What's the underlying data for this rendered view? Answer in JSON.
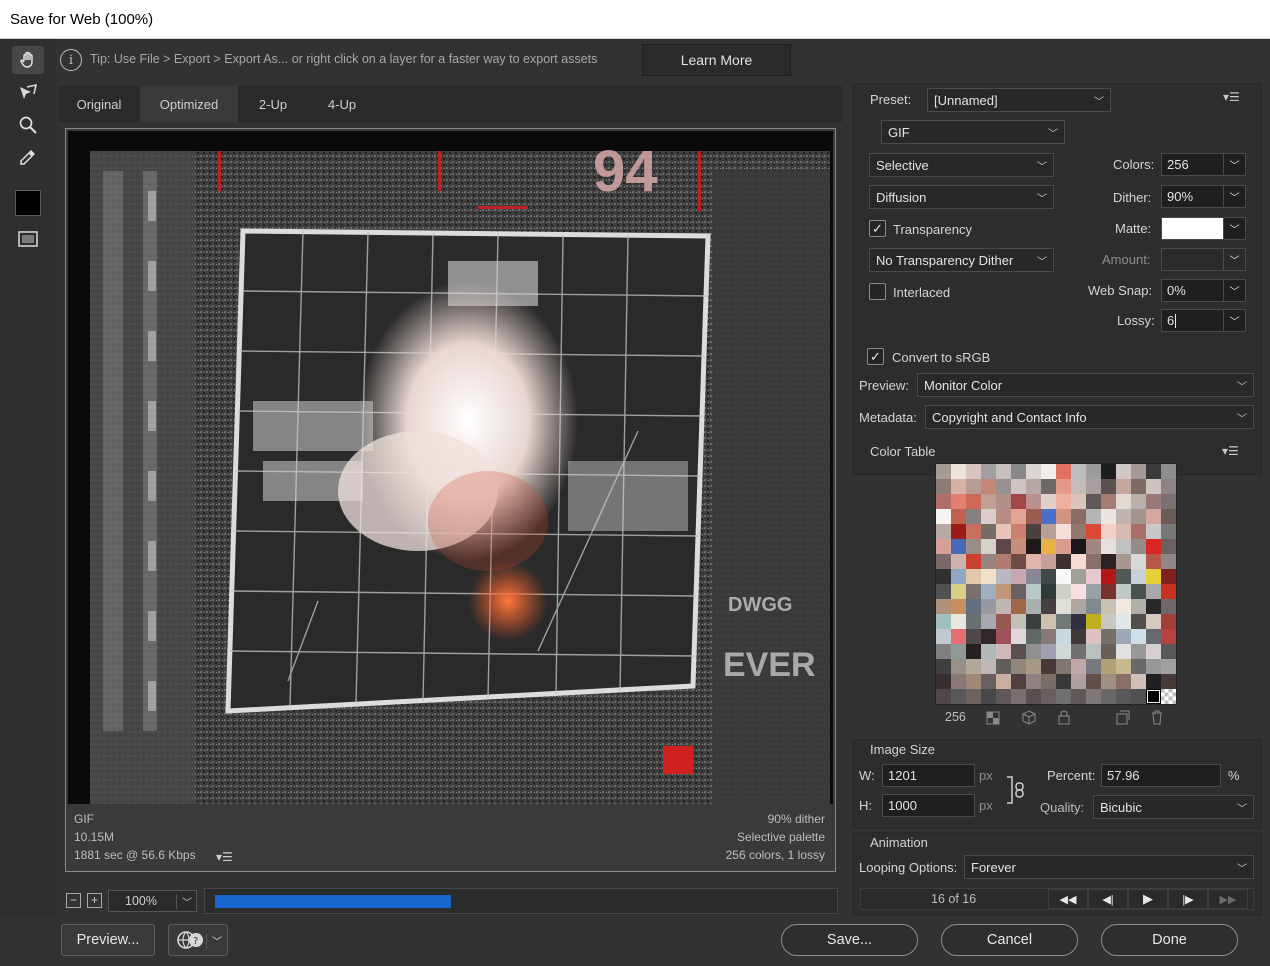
{
  "window": {
    "title": "Save for Web (100%)"
  },
  "tools": [
    {
      "name": "hand-tool",
      "icon": "hand-icon"
    },
    {
      "name": "slice-select-tool",
      "icon": "slice-select-icon"
    },
    {
      "name": "zoom-tool",
      "icon": "magnifier-icon"
    },
    {
      "name": "eyedropper-tool",
      "icon": "eyedropper-icon"
    },
    {
      "name": "eyedropper-color",
      "icon": "color-swatch-icon",
      "color": "#000000"
    },
    {
      "name": "toggle-slices-visibility",
      "icon": "slices-visibility-icon"
    }
  ],
  "tip": {
    "text": "Tip: Use File > Export > Export As...  or right click on a layer for a faster way to export assets",
    "learn_more": "Learn More"
  },
  "tabs": [
    {
      "label": "Original",
      "selected": false
    },
    {
      "label": "Optimized",
      "selected": true
    },
    {
      "label": "2-Up",
      "selected": false
    },
    {
      "label": "4-Up",
      "selected": false
    }
  ],
  "image_info": {
    "format": "GIF",
    "size": "10.15M",
    "download": "1881 sec @ 56.6 Kbps",
    "dither": "90% dither",
    "palette": "Selective palette",
    "summary": "256 colors, 1 lossy"
  },
  "zoom": {
    "value": "100%",
    "progress_fraction": 0.385
  },
  "buttons": {
    "preview": "Preview...",
    "save": "Save...",
    "cancel": "Cancel",
    "done": "Done"
  },
  "settings": {
    "preset_label": "Preset:",
    "preset_value": "[Unnamed]",
    "format": "GIF",
    "reduction": "Selective",
    "dither_algo": "Diffusion",
    "transparency_label": "Transparency",
    "transparency_checked": true,
    "transparency_dither": "No Transparency Dither",
    "interlaced_label": "Interlaced",
    "interlaced_checked": false,
    "colors_label": "Colors:",
    "colors_value": "256",
    "dither_label": "Dither:",
    "dither_value": "90%",
    "matte_label": "Matte:",
    "matte_color": "#ffffff",
    "amount_label": "Amount:",
    "amount_value": "",
    "websnap_label": "Web Snap:",
    "websnap_value": "0%",
    "lossy_label": "Lossy:",
    "lossy_value": "6",
    "convert_srgb_label": "Convert to sRGB",
    "convert_srgb_checked": true,
    "preview_label": "Preview:",
    "preview_value": "Monitor Color",
    "metadata_label": "Metadata:",
    "metadata_value": "Copyright and Contact Info"
  },
  "color_table": {
    "title": "Color Table",
    "count": "256",
    "colors": [
      "#a59c95",
      "#ece2df",
      "#d8c5c1",
      "#a0a0a0",
      "#c8c0bc",
      "#888888",
      "#dcd4d2",
      "#f4eeea",
      "#e07060",
      "#bcbcbc",
      "#9c9c9c",
      "#1e1e1e",
      "#cfc8c4",
      "#a89898",
      "#3a3a3a",
      "#8e8e8e",
      "#8c7a74",
      "#d8b0a6",
      "#b89c94",
      "#c48878",
      "#989090",
      "#d0c4c0",
      "#b4a8a4",
      "#6c6868",
      "#e89888",
      "#c4bcb8",
      "#a8a0a0",
      "#5c5050",
      "#c4a8a0",
      "#7c6c68",
      "#ccc4c0",
      "#8c8484",
      "#b07068",
      "#e48070",
      "#d06858",
      "#c0a094",
      "#b09088",
      "#a04848",
      "#bc9090",
      "#e0d0cc",
      "#f0b0a0",
      "#dcc4bc",
      "#605858",
      "#a47c74",
      "#e4d8d4",
      "#b8b0ac",
      "#987878",
      "#7c7070",
      "#f8f4f2",
      "#c06050",
      "#888080",
      "#dccccc",
      "#b88c84",
      "#e4a494",
      "#9c5c54",
      "#4c70c8",
      "#d09484",
      "#8c6c64",
      "#b4b4b4",
      "#ece4e0",
      "#c0b4b0",
      "#a49490",
      "#d4a8a0",
      "#6c5c58",
      "#b8a8a4",
      "#9c1c1c",
      "#c87060",
      "#786c68",
      "#e8c4b8",
      "#cc8070",
      "#4c4040",
      "#b8a098",
      "#f4e0d8",
      "#907870",
      "#dc4838",
      "#f0d0c8",
      "#d8b8b0",
      "#a87068",
      "#c8c8c8",
      "#787878",
      "#d8a098",
      "#4868b8",
      "#9c8c88",
      "#d8d0cc",
      "#5c4848",
      "#c4907c",
      "#201818",
      "#e8b048",
      "#d89c90",
      "#181818",
      "#a08880",
      "#e8e0dc",
      "#c0c0c0",
      "#948c88",
      "#d82820",
      "#6c6060",
      "#7c6868",
      "#ccb4ac",
      "#c84030",
      "#988480",
      "#b07c70",
      "#6c4c44",
      "#e0b4a8",
      "#c4a098",
      "#3c3030",
      "#f8dcd0",
      "#887070",
      "#2c2424",
      "#a89890",
      "#d8d8d8",
      "#b45848",
      "#908888",
      "#303030",
      "#90a8c8",
      "#e0c8a8",
      "#f0e0c8",
      "#b8b8c0",
      "#c8a8b0",
      "#888898",
      "#404848",
      "#f8f8f8",
      "#a0a098",
      "#e8c8d0",
      "#b01818",
      "#505858",
      "#c8d0d8",
      "#e8d038",
      "#802020",
      "#505050",
      "#d8d088",
      "#787070",
      "#a0b0c0",
      "#c09878",
      "#686060",
      "#b8c8c8",
      "#303838",
      "#d0d0c8",
      "#f8e0e0",
      "#98a0a8",
      "#783030",
      "#c0c8c8",
      "#485050",
      "#a8a8a8",
      "#c83020",
      "#b09078",
      "#c89060",
      "#607080",
      "#9898a0",
      "#c0b8b0",
      "#a06848",
      "#a8b0b0",
      "#484040",
      "#e0e0d8",
      "#b0a8a0",
      "#808890",
      "#c8c0b0",
      "#f0e8e0",
      "#b0b0a8",
      "#282828",
      "#706868",
      "#a0c0c0",
      "#e8e8e0",
      "#687070",
      "#a8a8b0",
      "#985850",
      "#c0c0b8",
      "#384040",
      "#d0c0b0",
      "#707878",
      "#303040",
      "#c0b020",
      "#c8c8c0",
      "#e0e8e8",
      "#505048",
      "#d8c8c0",
      "#a04038",
      "#c0c8d0",
      "#e07070",
      "#504848",
      "#302828",
      "#a05058",
      "#e0d8d8",
      "#606868",
      "#887878",
      "#c8d8e0",
      "#403838",
      "#e0c0c0",
      "#787068",
      "#a0a8b8",
      "#d0e0e8",
      "#686870",
      "#b84040",
      "#808080",
      "#909898",
      "#282020",
      "#b0b8b8",
      "#d0b8b8",
      "#585050",
      "#909090",
      "#a0a0b0",
      "#d0d8d8",
      "#707070",
      "#b8c0c0",
      "#686058",
      "#e0e0e0",
      "#989898",
      "#d8d0d0",
      "#585858",
      "#404040",
      "#989088",
      "#b0a898",
      "#c0b8b8",
      "#606058",
      "#908878",
      "#a89888",
      "#483838",
      "#807870",
      "#c0a8a8",
      "#787880",
      "#b0a078",
      "#c8b890",
      "#686868",
      "#989898",
      "#a0a0a0",
      "#383030",
      "#887878",
      "#a08878",
      "#686060",
      "#c8b0a0",
      "#504040",
      "#908080",
      "#787068",
      "#383838",
      "#b0a0a0",
      "#605048",
      "#a09080",
      "#887068",
      "#d0c0b8",
      "#202020",
      "#483838",
      "#504848",
      "#585858",
      "#706060",
      "#484848",
      "#605858",
      "#787070",
      "#585050",
      "#686060",
      "#707070",
      "#605858",
      "#807878",
      "#686868",
      "#585858",
      "#505050",
      "#000000",
      "#ffffff"
    ]
  },
  "image_size": {
    "title": "Image Size",
    "w_label": "W:",
    "w_value": "1201",
    "h_label": "H:",
    "h_value": "1000",
    "unit": "px",
    "percent_label": "Percent:",
    "percent_value": "57.96",
    "percent_unit": "%",
    "quality_label": "Quality:",
    "quality_value": "Bicubic"
  },
  "animation": {
    "title": "Animation",
    "looping_label": "Looping Options:",
    "looping_value": "Forever",
    "frame_counter": "16 of 16"
  },
  "colors": {
    "accent": "#1666cc",
    "panel_bg": "#323232",
    "section_bg": "#2d2d2d"
  }
}
